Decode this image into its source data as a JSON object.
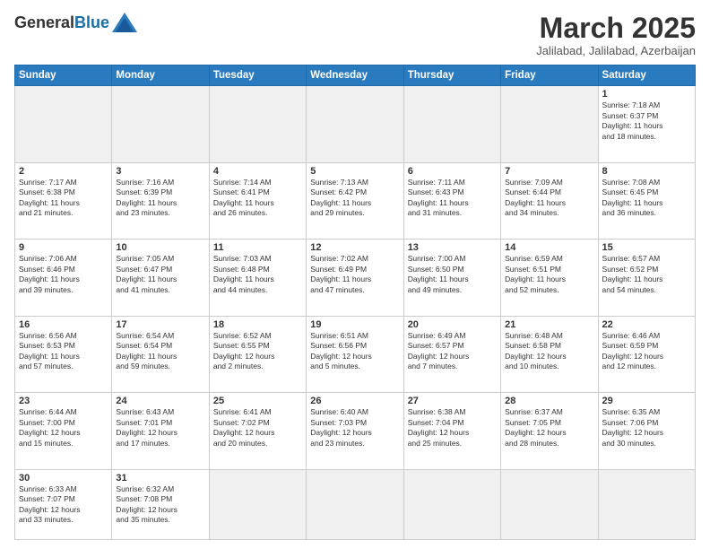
{
  "logo": {
    "general": "General",
    "blue": "Blue"
  },
  "header": {
    "month": "March 2025",
    "location": "Jalilabad, Jalilabad, Azerbaijan"
  },
  "days": [
    "Sunday",
    "Monday",
    "Tuesday",
    "Wednesday",
    "Thursday",
    "Friday",
    "Saturday"
  ],
  "weeks": [
    [
      {
        "num": "",
        "info": ""
      },
      {
        "num": "",
        "info": ""
      },
      {
        "num": "",
        "info": ""
      },
      {
        "num": "",
        "info": ""
      },
      {
        "num": "",
        "info": ""
      },
      {
        "num": "",
        "info": ""
      },
      {
        "num": "1",
        "info": "Sunrise: 7:18 AM\nSunset: 6:37 PM\nDaylight: 11 hours\nand 18 minutes."
      }
    ],
    [
      {
        "num": "2",
        "info": "Sunrise: 7:17 AM\nSunset: 6:38 PM\nDaylight: 11 hours\nand 21 minutes."
      },
      {
        "num": "3",
        "info": "Sunrise: 7:16 AM\nSunset: 6:39 PM\nDaylight: 11 hours\nand 23 minutes."
      },
      {
        "num": "4",
        "info": "Sunrise: 7:14 AM\nSunset: 6:41 PM\nDaylight: 11 hours\nand 26 minutes."
      },
      {
        "num": "5",
        "info": "Sunrise: 7:13 AM\nSunset: 6:42 PM\nDaylight: 11 hours\nand 29 minutes."
      },
      {
        "num": "6",
        "info": "Sunrise: 7:11 AM\nSunset: 6:43 PM\nDaylight: 11 hours\nand 31 minutes."
      },
      {
        "num": "7",
        "info": "Sunrise: 7:09 AM\nSunset: 6:44 PM\nDaylight: 11 hours\nand 34 minutes."
      },
      {
        "num": "8",
        "info": "Sunrise: 7:08 AM\nSunset: 6:45 PM\nDaylight: 11 hours\nand 36 minutes."
      }
    ],
    [
      {
        "num": "9",
        "info": "Sunrise: 7:06 AM\nSunset: 6:46 PM\nDaylight: 11 hours\nand 39 minutes."
      },
      {
        "num": "10",
        "info": "Sunrise: 7:05 AM\nSunset: 6:47 PM\nDaylight: 11 hours\nand 41 minutes."
      },
      {
        "num": "11",
        "info": "Sunrise: 7:03 AM\nSunset: 6:48 PM\nDaylight: 11 hours\nand 44 minutes."
      },
      {
        "num": "12",
        "info": "Sunrise: 7:02 AM\nSunset: 6:49 PM\nDaylight: 11 hours\nand 47 minutes."
      },
      {
        "num": "13",
        "info": "Sunrise: 7:00 AM\nSunset: 6:50 PM\nDaylight: 11 hours\nand 49 minutes."
      },
      {
        "num": "14",
        "info": "Sunrise: 6:59 AM\nSunset: 6:51 PM\nDaylight: 11 hours\nand 52 minutes."
      },
      {
        "num": "15",
        "info": "Sunrise: 6:57 AM\nSunset: 6:52 PM\nDaylight: 11 hours\nand 54 minutes."
      }
    ],
    [
      {
        "num": "16",
        "info": "Sunrise: 6:56 AM\nSunset: 6:53 PM\nDaylight: 11 hours\nand 57 minutes."
      },
      {
        "num": "17",
        "info": "Sunrise: 6:54 AM\nSunset: 6:54 PM\nDaylight: 11 hours\nand 59 minutes."
      },
      {
        "num": "18",
        "info": "Sunrise: 6:52 AM\nSunset: 6:55 PM\nDaylight: 12 hours\nand 2 minutes."
      },
      {
        "num": "19",
        "info": "Sunrise: 6:51 AM\nSunset: 6:56 PM\nDaylight: 12 hours\nand 5 minutes."
      },
      {
        "num": "20",
        "info": "Sunrise: 6:49 AM\nSunset: 6:57 PM\nDaylight: 12 hours\nand 7 minutes."
      },
      {
        "num": "21",
        "info": "Sunrise: 6:48 AM\nSunset: 6:58 PM\nDaylight: 12 hours\nand 10 minutes."
      },
      {
        "num": "22",
        "info": "Sunrise: 6:46 AM\nSunset: 6:59 PM\nDaylight: 12 hours\nand 12 minutes."
      }
    ],
    [
      {
        "num": "23",
        "info": "Sunrise: 6:44 AM\nSunset: 7:00 PM\nDaylight: 12 hours\nand 15 minutes."
      },
      {
        "num": "24",
        "info": "Sunrise: 6:43 AM\nSunset: 7:01 PM\nDaylight: 12 hours\nand 17 minutes."
      },
      {
        "num": "25",
        "info": "Sunrise: 6:41 AM\nSunset: 7:02 PM\nDaylight: 12 hours\nand 20 minutes."
      },
      {
        "num": "26",
        "info": "Sunrise: 6:40 AM\nSunset: 7:03 PM\nDaylight: 12 hours\nand 23 minutes."
      },
      {
        "num": "27",
        "info": "Sunrise: 6:38 AM\nSunset: 7:04 PM\nDaylight: 12 hours\nand 25 minutes."
      },
      {
        "num": "28",
        "info": "Sunrise: 6:37 AM\nSunset: 7:05 PM\nDaylight: 12 hours\nand 28 minutes."
      },
      {
        "num": "29",
        "info": "Sunrise: 6:35 AM\nSunset: 7:06 PM\nDaylight: 12 hours\nand 30 minutes."
      }
    ],
    [
      {
        "num": "30",
        "info": "Sunrise: 6:33 AM\nSunset: 7:07 PM\nDaylight: 12 hours\nand 33 minutes."
      },
      {
        "num": "31",
        "info": "Sunrise: 6:32 AM\nSunset: 7:08 PM\nDaylight: 12 hours\nand 35 minutes."
      },
      {
        "num": "",
        "info": ""
      },
      {
        "num": "",
        "info": ""
      },
      {
        "num": "",
        "info": ""
      },
      {
        "num": "",
        "info": ""
      },
      {
        "num": "",
        "info": ""
      }
    ]
  ]
}
